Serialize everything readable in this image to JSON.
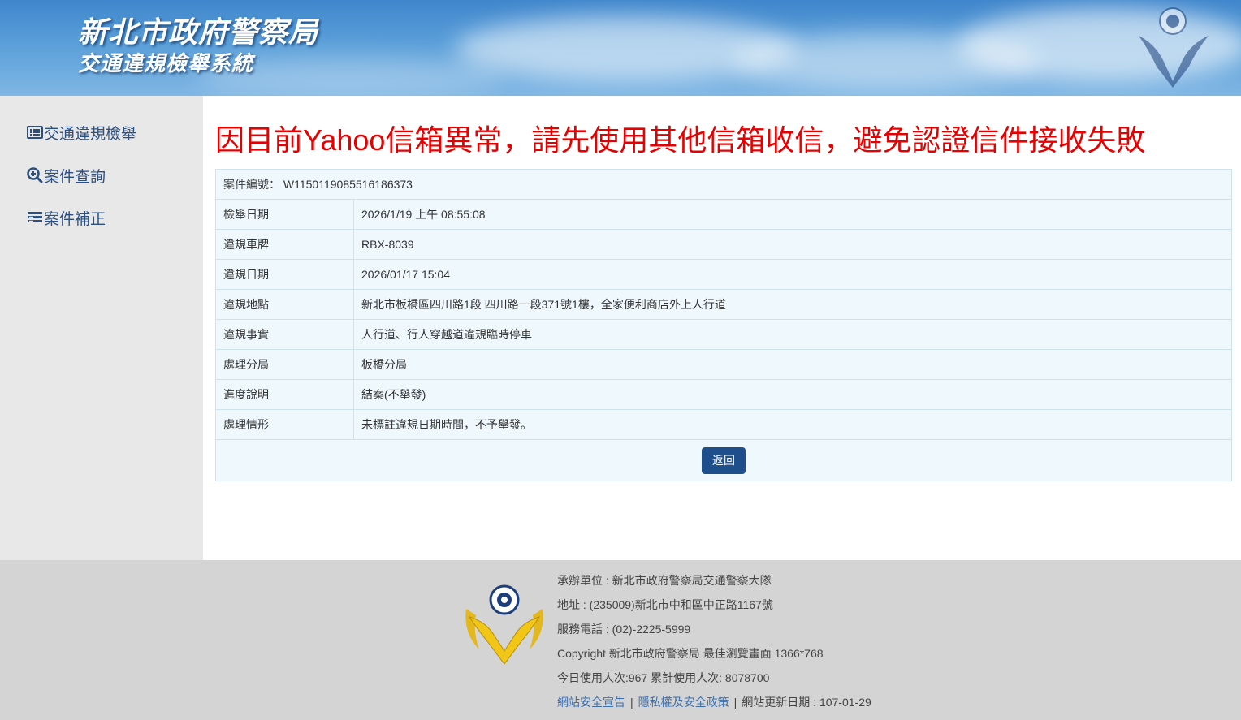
{
  "header": {
    "title": "新北市政府警察局",
    "subtitle": "交通違規檢舉系統"
  },
  "sidebar": {
    "items": [
      {
        "label": "交通違規檢舉",
        "icon": "list-card-icon"
      },
      {
        "label": "案件查詢",
        "icon": "search-plus-icon"
      },
      {
        "label": "案件補正",
        "icon": "form-lines-icon"
      }
    ]
  },
  "notice": "因目前Yahoo信箱異常，請先使用其他信箱收信，避免認證信件接收失敗",
  "case": {
    "id_label": "案件編號：",
    "id_value": "W1150119085516186373",
    "rows": [
      {
        "label": "檢舉日期",
        "value": "2026/1/19 上午 08:55:08"
      },
      {
        "label": "違規車牌",
        "value": "RBX-8039"
      },
      {
        "label": "違規日期",
        "value": "2026/01/17 15:04"
      },
      {
        "label": "違規地點",
        "value": "新北市板橋區四川路1段 四川路一段371號1樓，全家便利商店外上人行道"
      },
      {
        "label": "違規事實",
        "value": "人行道、行人穿越道違規臨時停車"
      },
      {
        "label": "處理分局",
        "value": "板橋分局"
      },
      {
        "label": "進度說明",
        "value": "結案(不舉發)"
      },
      {
        "label": "處理情形",
        "value": "未標註違規日期時間，不予舉發。"
      }
    ],
    "back_label": "返回"
  },
  "footer": {
    "organizer": "承辦單位 : 新北市政府警察局交通警察大隊",
    "address": "地址 : (235009)新北市中和區中正路1167號",
    "phone": "服務電話 : (02)-2225-5999",
    "copyright": "Copyright 新北市政府警察局 最佳瀏覽畫面 1366*768",
    "visitors": "今日使用人次:967 累計使用人次: 8078700",
    "links": {
      "security": "網站安全宣告",
      "privacy": "隱私權及安全政策",
      "updated": "網站更新日期 : 107-01-29"
    },
    "separator": "|"
  },
  "colors": {
    "notice": "#e60000",
    "button": "#1f4e8c",
    "sidebar_text": "#2b4f82",
    "table_bg": "#eef8fd",
    "footer_bg": "#d4d4d4"
  }
}
